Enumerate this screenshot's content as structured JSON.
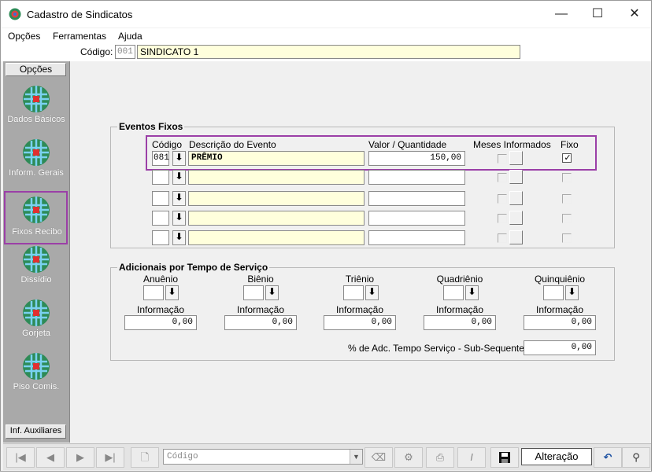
{
  "window": {
    "title": "Cadastro de Sindicatos",
    "controls": {
      "minimize": "—",
      "maximize": "☐",
      "close": "✕"
    }
  },
  "menu": [
    "Opções",
    "Ferramentas",
    "Ajuda"
  ],
  "header": {
    "codigo_label": "Código:",
    "codigo_value": "001",
    "nome_value": "SINDICATO 1"
  },
  "sidebar": {
    "title": "Opções",
    "items": [
      {
        "label": "Dados Básicos",
        "icon": "globe-icon"
      },
      {
        "label": "Inform. Gerais",
        "icon": "globe-icon"
      },
      {
        "label": "Fixos Recibo",
        "icon": "globe-icon",
        "selected": true
      },
      {
        "label": "Dissídio",
        "icon": "globe-icon"
      },
      {
        "label": "Gorjeta",
        "icon": "globe-icon"
      },
      {
        "label": "Piso Comis.",
        "icon": "globe-icon"
      }
    ],
    "footer": "Inf. Auxiliares"
  },
  "eventos": {
    "title": "Eventos Fixos",
    "headers": {
      "codigo": "Código",
      "descricao": "Descrição do Evento",
      "valor": "Valor / Quantidade",
      "meses": "Meses Informados",
      "fixo": "Fixo"
    },
    "rows": [
      {
        "codigo": "081",
        "descricao": "PRÊMIO",
        "valor": "150,00",
        "fixo": true
      },
      {
        "codigo": "",
        "descricao": "",
        "valor": "",
        "fixo": false
      },
      {
        "codigo": "",
        "descricao": "",
        "valor": "",
        "fixo": false
      },
      {
        "codigo": "",
        "descricao": "",
        "valor": "",
        "fixo": false
      },
      {
        "codigo": "",
        "descricao": "",
        "valor": "",
        "fixo": false
      }
    ]
  },
  "adicionais": {
    "title": "Adicionais por Tempo de Serviço",
    "periods": [
      {
        "label": "Anuênio",
        "info_label": "Informação",
        "info_value": "0,00"
      },
      {
        "label": "Biênio",
        "info_label": "Informação",
        "info_value": "0,00"
      },
      {
        "label": "Triênio",
        "info_label": "Informação",
        "info_value": "0,00"
      },
      {
        "label": "Quadriênio",
        "info_label": "Informação",
        "info_value": "0,00"
      },
      {
        "label": "Quinquiênio",
        "info_label": "Informação",
        "info_value": "0,00"
      }
    ],
    "subsequente_label": "% de Adc. Tempo Serviço - Sub-Sequente:",
    "subsequente_value": "0,00"
  },
  "toolbar": {
    "first": "|◀",
    "prev": "◀",
    "next": "▶",
    "last": "▶|",
    "combo_placeholder": "Código",
    "status": "Alteração",
    "undo": "↶",
    "find": "⚲"
  },
  "colors": {
    "highlight": "#9b3fa7",
    "input_yellow": "#ffffdc",
    "sidebar_bg": "#a9a9a9"
  }
}
